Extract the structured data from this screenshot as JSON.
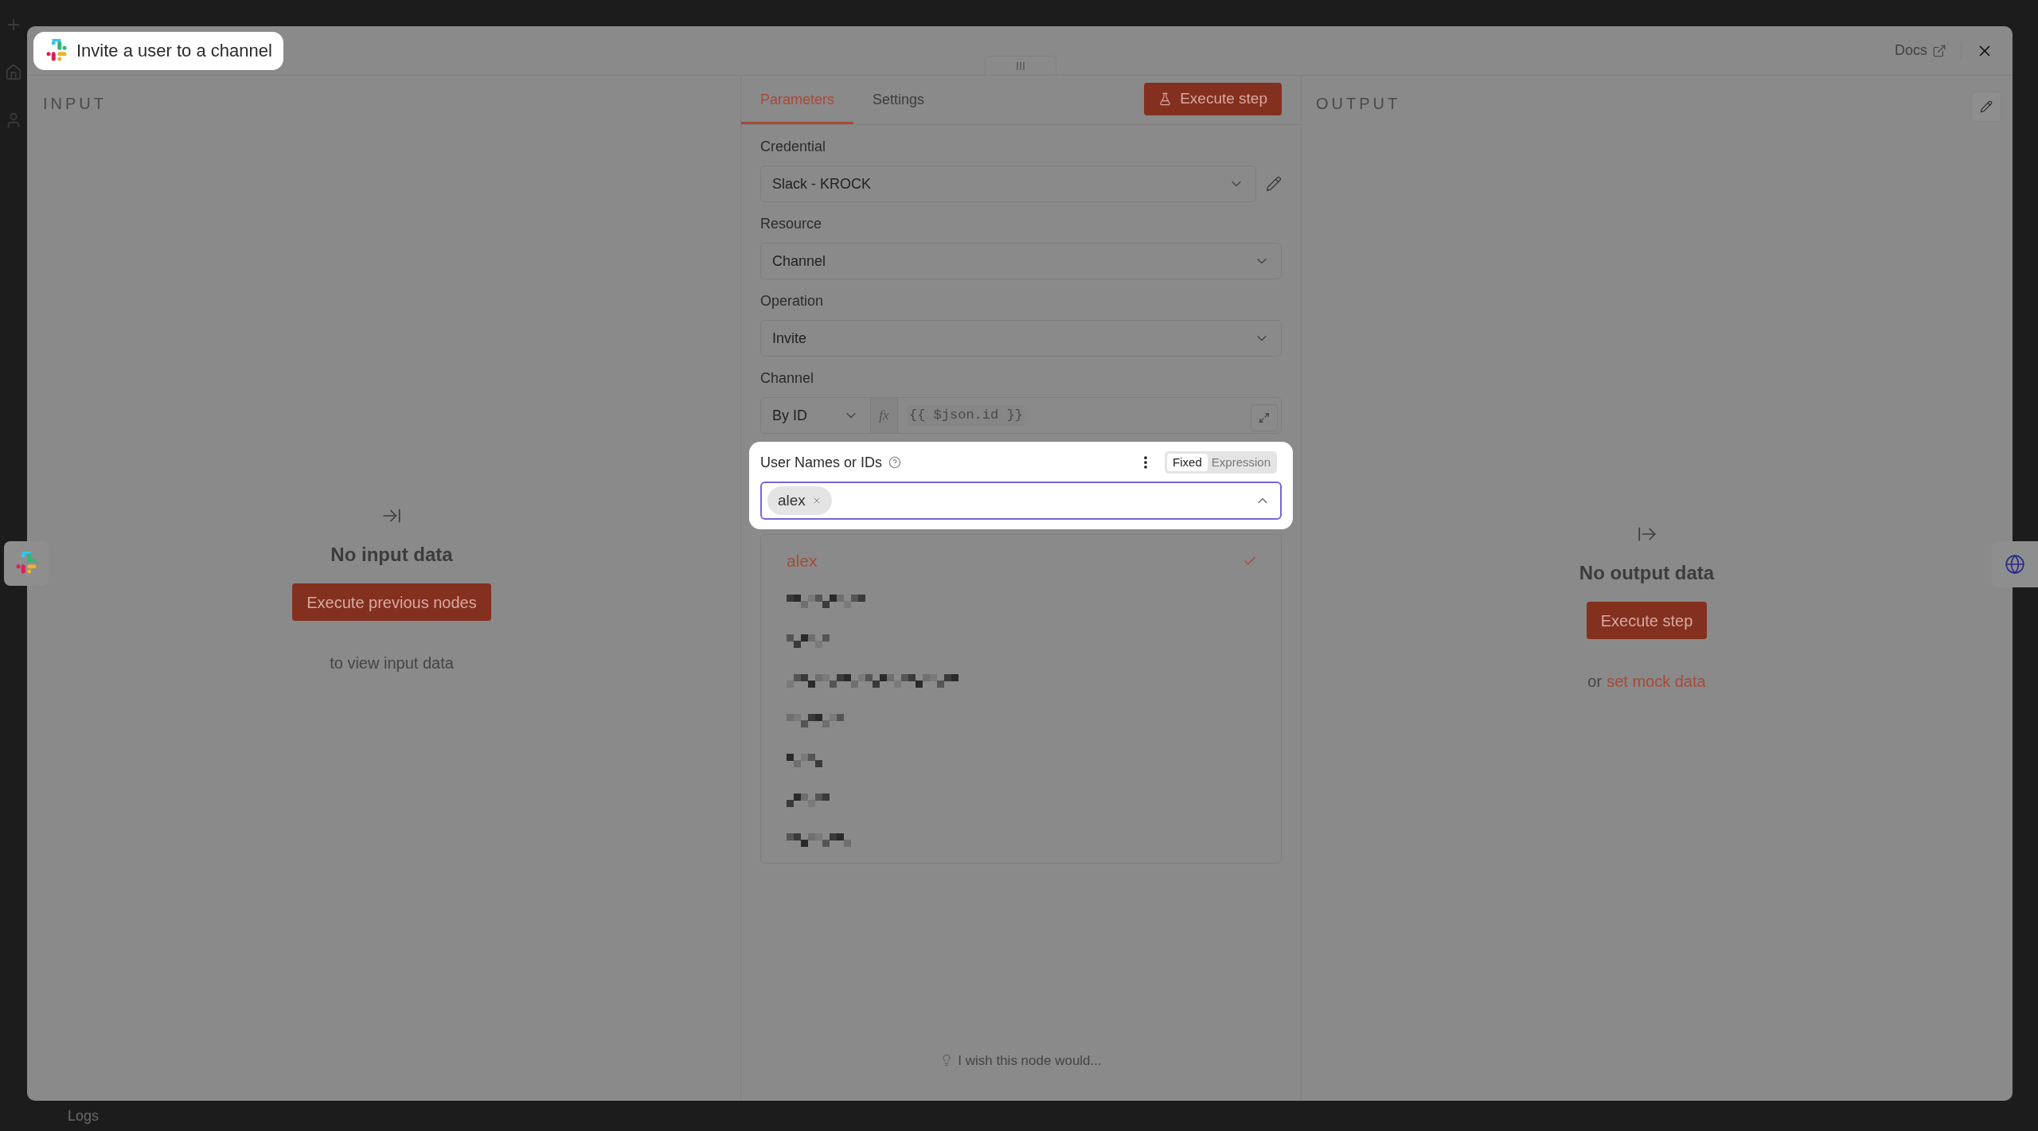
{
  "modal": {
    "title": "Invite a user to a channel",
    "docs_link": "Docs"
  },
  "input_panel": {
    "heading": "INPUT",
    "empty_title": "No input data",
    "button": "Execute previous nodes",
    "hint": "to view input data"
  },
  "parameters": {
    "tabs": [
      {
        "label": "Parameters",
        "selected": true
      },
      {
        "label": "Settings",
        "selected": false
      }
    ],
    "execute_button": "Execute step",
    "fields": [
      {
        "kind": "select",
        "label": "Credential",
        "value": "Slack - KROCK",
        "edit_icon": true
      },
      {
        "kind": "select",
        "label": "Resource",
        "value": "Channel",
        "edit_icon": false
      },
      {
        "kind": "select",
        "label": "Operation",
        "value": "Invite",
        "edit_icon": false
      },
      {
        "kind": "locator",
        "label": "Channel",
        "mode": "By ID",
        "fx_label": "fx",
        "value": "{{ $json.id }}"
      }
    ],
    "user_field": {
      "label": "User Names or IDs",
      "mode_toggle": [
        {
          "label": "Fixed",
          "selected": true
        },
        {
          "label": "Expression",
          "selected": false
        }
      ],
      "tags": [
        "alex"
      ],
      "expanded": true,
      "options": [
        {
          "kind": "text",
          "label": "alex",
          "selected": true
        },
        {
          "kind": "redacted",
          "selected": false
        },
        {
          "kind": "redacted",
          "selected": false
        },
        {
          "kind": "redacted",
          "selected": false
        },
        {
          "kind": "redacted",
          "selected": false
        },
        {
          "kind": "redacted",
          "selected": false
        },
        {
          "kind": "redacted",
          "selected": false
        },
        {
          "kind": "redacted",
          "selected": false
        }
      ]
    },
    "feedback": "I wish this node would..."
  },
  "output_panel": {
    "heading": "OUTPUT",
    "empty_title": "No output data",
    "button": "Execute step",
    "hint_prefix": "or",
    "hint_link": "set mock data"
  },
  "bottom_bar": {
    "logs": "Logs"
  }
}
